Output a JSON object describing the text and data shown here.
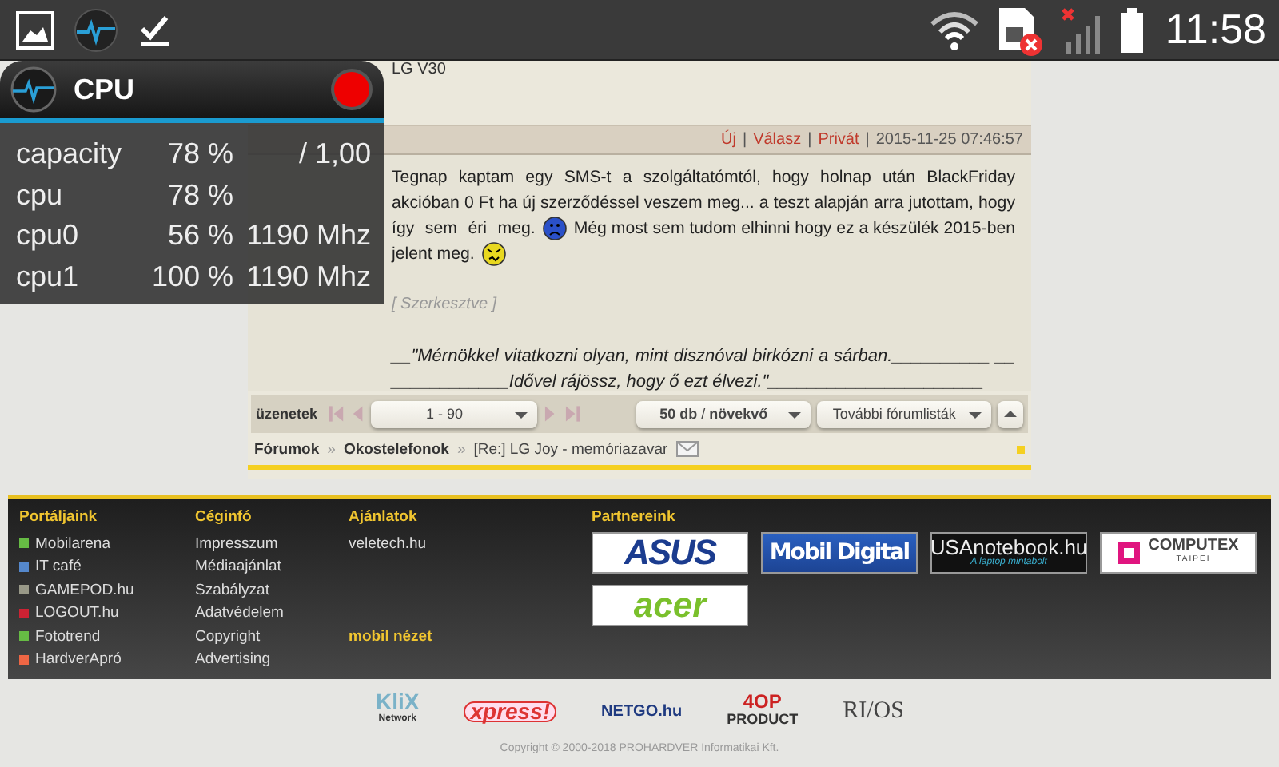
{
  "status_bar": {
    "time": "11:58"
  },
  "cpu_widget": {
    "title": "CPU",
    "rows": [
      {
        "name": "capacity",
        "percent": "78 %",
        "extra": "/ 1,00"
      },
      {
        "name": "cpu",
        "percent": "78 %"
      },
      {
        "name": "cpu0",
        "percent": "56 %",
        "extra": "1190 Mhz"
      },
      {
        "name": "cpu1",
        "percent": "100 %",
        "extra": "1190 Mhz"
      }
    ]
  },
  "topic_title": "LG V30",
  "post": {
    "links": [
      "Új",
      "Válasz",
      "Privát"
    ],
    "separator": "|",
    "date": "2015-11-25 07:46:57",
    "body": [
      [
        {
          "kind": "text",
          "text": "Tegnap kaptam egy SMS-t a szolgáltatómtól, hogy holnap után BlackFriday"
        }
      ],
      [
        {
          "kind": "text",
          "text": "akcióban 0 Ft ha új szerződéssel veszem meg... a teszt alapján arra jutottam, hogy"
        }
      ],
      [
        {
          "kind": "text",
          "text": "így sem éri meg."
        },
        {
          "kind": "sad_emoticon"
        },
        {
          "kind": "text",
          "text": "Még most sem tudom elhinni hogy ez a készülék 2015-ben"
        }
      ],
      [
        {
          "kind": "text",
          "text": "jelent meg."
        },
        {
          "kind": "confused_emoticon"
        }
      ]
    ],
    "edited": "[ Szerkesztve ]",
    "signature": "__\"Mérnökkel vitatkozni olyan, mint disznóval birkózni a sárban.__________ ______________Idővel rájössz, hogy ő ezt élvezi.\"______________________"
  },
  "pager": {
    "label": "üzenetek",
    "range": "1 - 90",
    "sort": "**50 db** / **növekvő**",
    "more": "További fórumlisták"
  },
  "breadcrumb": {
    "separator": "»",
    "items": [
      {
        "text": "Fórumok",
        "kind": "link"
      },
      {
        "text": "Okostelefonok",
        "kind": "link"
      },
      {
        "text": "[Re:] LG Joy - memóriazavar",
        "kind": "current"
      }
    ]
  },
  "footer": {
    "columns": [
      {
        "heading": "Portáljaink",
        "items": [
          {
            "text": "Mobilarena",
            "kind": "portal",
            "color": "#66bb44"
          },
          {
            "text": "IT café",
            "kind": "portal",
            "color": "#5588cc"
          },
          {
            "text": "GAMEPOD.hu",
            "kind": "portal",
            "color": "#999988"
          },
          {
            "text": "LOGOUT.hu",
            "kind": "portal",
            "color": "#cc2233"
          },
          {
            "text": "Fototrend",
            "kind": "portal",
            "color": "#66bb44"
          },
          {
            "text": "HardverApró",
            "kind": "portal",
            "color": "#ee6644"
          }
        ]
      },
      {
        "heading": "Céginfó",
        "items": [
          {
            "text": "Impresszum",
            "kind": "link"
          },
          {
            "text": "Médiaajánlat",
            "kind": "link"
          },
          {
            "text": "Szabályzat",
            "kind": "link"
          },
          {
            "text": "Adatvédelem",
            "kind": "link"
          },
          {
            "text": "Copyright",
            "kind": "link"
          },
          {
            "text": "Advertising",
            "kind": "link"
          }
        ]
      },
      {
        "heading": "Ajánlatok",
        "items": [
          {
            "text": "veletech.hu",
            "kind": "link"
          },
          {
            "text": "mobil nézet",
            "kind": "highlight"
          }
        ]
      }
    ],
    "partners": {
      "heading": "Partnereink",
      "logos": [
        {
          "kind": "asus",
          "text": "ASUS"
        },
        {
          "kind": "mobildigital",
          "text": "Mobil Digital"
        },
        {
          "kind": "usanotebook",
          "text": "USAnotebook.hu",
          "sub": "A laptop mintabolt"
        },
        {
          "kind": "computex",
          "text": "COMPUTEX",
          "sub": "TAIPEI"
        },
        {
          "kind": "acer",
          "text": "acer"
        }
      ]
    }
  },
  "sponsors": [
    {
      "kind": "klix",
      "text": "KliX",
      "sub": "Network"
    },
    {
      "kind": "xpress",
      "text": "xpress!"
    },
    {
      "kind": "netgo",
      "text": "NETGO.hu"
    },
    {
      "kind": "fourop",
      "text": "4OP",
      "sub": "PRODUCT"
    },
    {
      "kind": "rios",
      "text": "RI/OS"
    }
  ],
  "copyright": "Copyright © 2000-2018 PROHARDVER Informatikai Kft."
}
